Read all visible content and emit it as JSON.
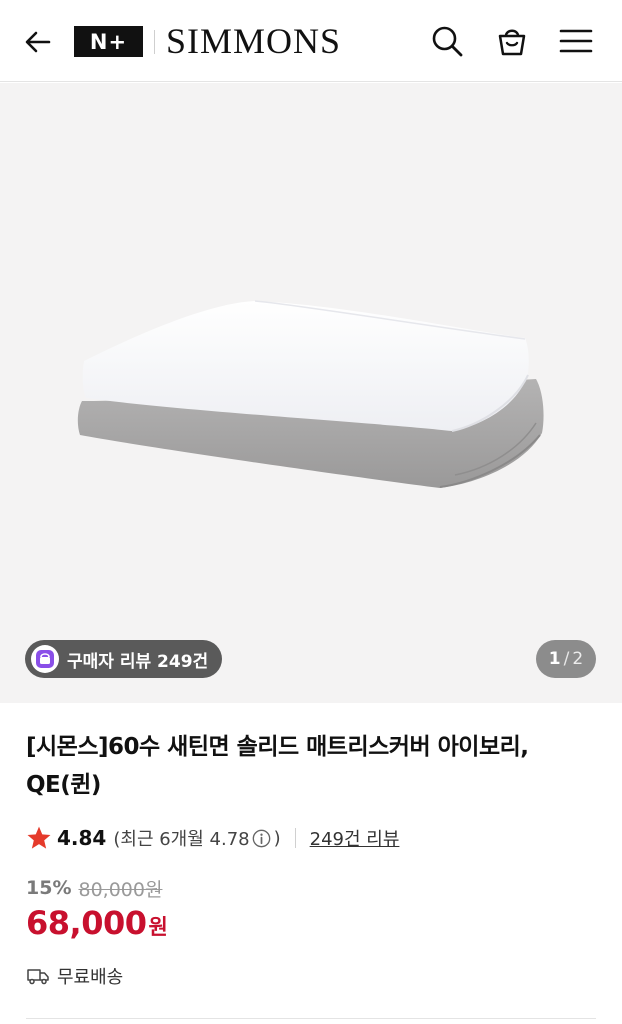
{
  "header": {
    "logo_mark": "N+",
    "brand": "SIMMONS",
    "icons": [
      "back-arrow-icon",
      "search-icon",
      "shopping-bag-icon",
      "hamburger-menu-icon"
    ]
  },
  "gallery": {
    "review_badge": "구매자 리뷰 249건",
    "current_page": "1",
    "separator": "/",
    "total_pages": "2",
    "badge_color": "#8a4fe8"
  },
  "product": {
    "title": "[시몬스]60수 새틴면 솔리드 매트리스커버 아이보리, QE(퀸)",
    "rating": "4.84",
    "recent_rating_prefix": "(최근 6개월 4.78",
    "recent_rating_suffix": ")",
    "review_count_link": "249건 리뷰",
    "discount": "15%",
    "original_price": "80,000원",
    "sale_price": "68,000",
    "currency": "원",
    "shipping": "무료배송",
    "accent_color": "#c8102e",
    "star_color": "#e53a2b"
  }
}
